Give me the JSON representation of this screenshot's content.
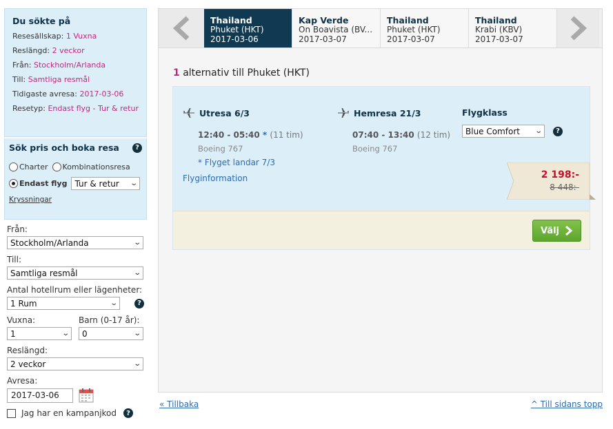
{
  "search_summary": {
    "title": "Du sökte på",
    "rows": [
      {
        "label": "Resesällskap:",
        "value": "1 Vuxna"
      },
      {
        "label": "Reslängd:",
        "value": "2 veckor"
      },
      {
        "label": "Från:",
        "value": "Stockholm/Arlanda"
      },
      {
        "label": "Till:",
        "value": "Samtliga resmål"
      },
      {
        "label": "Tidigaste avresa:",
        "value": "2017-03-06"
      },
      {
        "label": "Resetyp:",
        "value": "Endast flyg - Tur & retur"
      }
    ]
  },
  "booking": {
    "title": "Sök pris och boka resa",
    "radio_charter": "Charter",
    "radio_combo": "Kombinationsresa",
    "radio_flight": "Endast flyg",
    "trip_type": "Tur & retur",
    "cruises_link": "Kryssningar"
  },
  "form": {
    "from_label": "Från:",
    "from_value": "Stockholm/Arlanda",
    "to_label": "Till:",
    "to_value": "Samtliga resmål",
    "rooms_label": "Antal hotellrum eller lägenheter:",
    "rooms_value": "1 Rum",
    "adults_label": "Vuxna:",
    "adults_value": "1",
    "children_label": "Barn (0-17 år):",
    "children_value": "0",
    "length_label": "Reslängd:",
    "length_value": "2 veckor",
    "departure_label": "Avresa:",
    "departure_value": "2017-03-06",
    "campaign_label": "Jag har en kampanjkod"
  },
  "tabs": [
    {
      "country": "Thailand",
      "destination": "Phuket (HKT)",
      "date": "2017-03-06",
      "active": true
    },
    {
      "country": "Kap Verde",
      "destination": "Ön Boavista (BV...",
      "date": "2017-03-07",
      "active": false
    },
    {
      "country": "Thailand",
      "destination": "Phuket (HKT)",
      "date": "2017-03-07",
      "active": false
    },
    {
      "country": "Thailand",
      "destination": "Krabi (KBV)",
      "date": "2017-03-07",
      "active": false
    }
  ],
  "results": {
    "count": "1",
    "label": "alternativ till Phuket (HKT)"
  },
  "flight": {
    "outbound_title": "Utresa 6/3",
    "outbound_times": "12:40 - 05:40",
    "outbound_star": "*",
    "outbound_duration": "(11 tim)",
    "outbound_aircraft": "Boeing 767",
    "outbound_note": "* Flyget landar 7/3",
    "return_title": "Hemresa 21/3",
    "return_times": "07:40 - 13:40",
    "return_duration": "(12 tim)",
    "return_aircraft": "Boeing 767",
    "class_label": "Flygklass",
    "class_value": "Blue Comfort",
    "info_link": "Flyginformation",
    "price_new": "2 198:-",
    "price_old": "8 448:-",
    "select_button": "Välj"
  },
  "footer": {
    "back": "« Tillbaka",
    "top": "^ Till sidans topp"
  },
  "colors": {
    "accent_pink": "#c0287f",
    "navy": "#0f3a52",
    "panel_blue": "#dceef8",
    "price_red": "#c8102e",
    "button_green": "#6eb53c"
  }
}
